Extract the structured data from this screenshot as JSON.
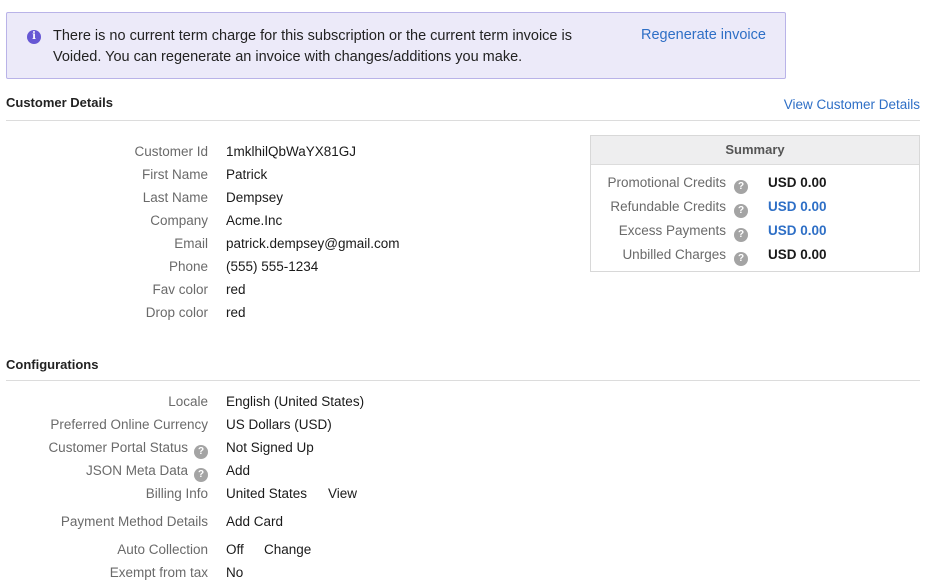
{
  "banner": {
    "message": "There is no current term charge for this subscription or the current term invoice is Voided. You can regenerate an invoice with changes/additions you make.",
    "action": "Regenerate invoice"
  },
  "customer_details": {
    "title": "Customer Details",
    "view_link": "View Customer Details",
    "fields": [
      {
        "label": "Customer Id",
        "value": "1mklhilQbWaYX81GJ"
      },
      {
        "label": "First Name",
        "value": "Patrick"
      },
      {
        "label": "Last Name",
        "value": "Dempsey"
      },
      {
        "label": "Company",
        "value": "Acme.Inc"
      },
      {
        "label": "Email",
        "value": "patrick.dempsey@gmail.com"
      },
      {
        "label": "Phone",
        "value": "(555) 555-1234"
      },
      {
        "label": "Fav color",
        "value": "red"
      },
      {
        "label": "Drop color",
        "value": "red"
      }
    ]
  },
  "summary": {
    "title": "Summary",
    "rows": [
      {
        "label": "Promotional Credits",
        "value": "USD 0.00"
      },
      {
        "label": "Refundable Credits",
        "value": "USD 0.00"
      },
      {
        "label": "Excess Payments",
        "value": "USD 0.00"
      },
      {
        "label": "Unbilled Charges",
        "value": "USD 0.00"
      }
    ]
  },
  "configurations": {
    "title": "Configurations",
    "locale": {
      "label": "Locale",
      "value": "English (United States)"
    },
    "currency": {
      "label": "Preferred Online Currency",
      "value": "US Dollars (USD)"
    },
    "portal": {
      "label": "Customer Portal Status",
      "value": "Not Signed Up"
    },
    "json_meta": {
      "label": "JSON Meta Data",
      "action": "Add"
    },
    "billing": {
      "label": "Billing Info",
      "value": "United States",
      "action": "View"
    },
    "payment": {
      "label": "Payment Method Details",
      "action": "Add Card"
    },
    "auto_collection": {
      "label": "Auto Collection",
      "value": "Off",
      "action": "Change"
    },
    "exempt_tax": {
      "label": "Exempt from tax",
      "value": "No"
    }
  },
  "icons": {
    "info": "info-icon",
    "help": "help-icon"
  },
  "colors": {
    "accent": "#2e6fc6",
    "banner_bg": "#eceaf9",
    "banner_icon": "#6657d4"
  }
}
